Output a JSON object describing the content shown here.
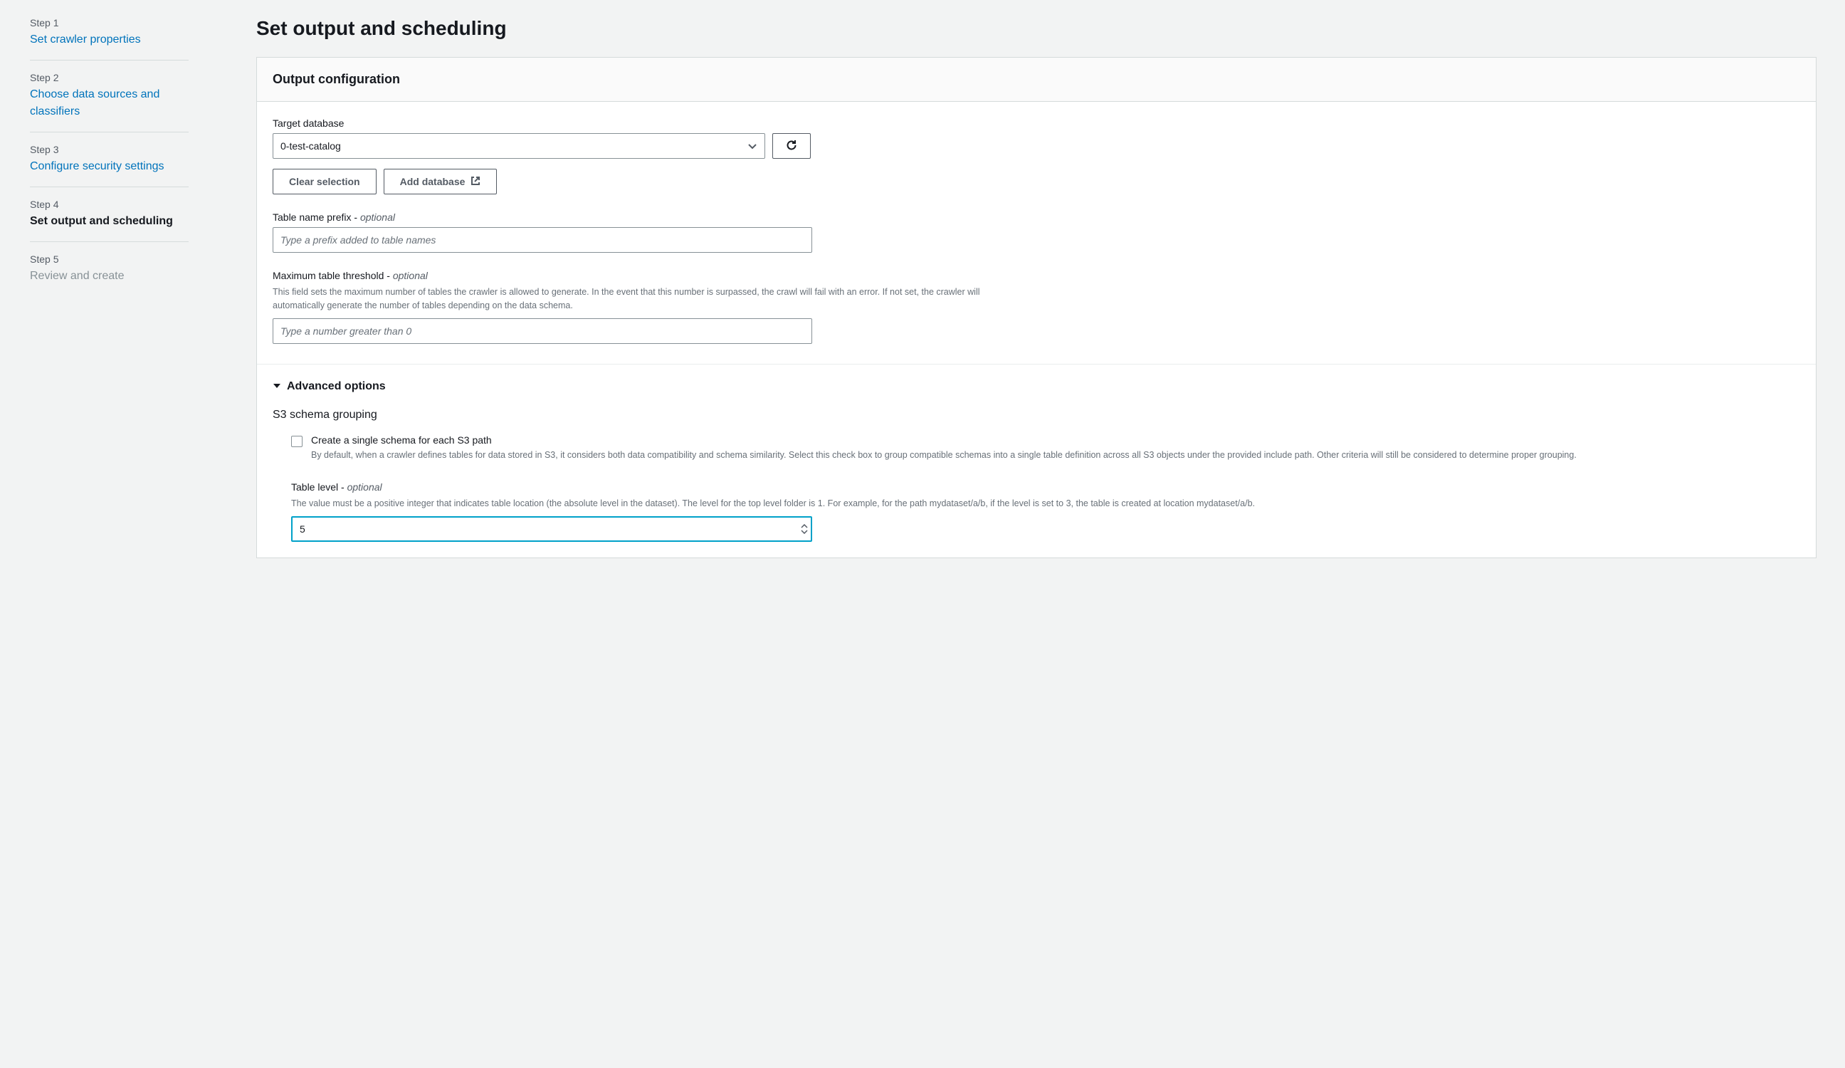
{
  "sidebar": {
    "steps": [
      {
        "label": "Step 1",
        "title": "Set crawler properties",
        "state": "link"
      },
      {
        "label": "Step 2",
        "title": "Choose data sources and classifiers",
        "state": "link"
      },
      {
        "label": "Step 3",
        "title": "Configure security settings",
        "state": "link"
      },
      {
        "label": "Step 4",
        "title": "Set output and scheduling",
        "state": "active"
      },
      {
        "label": "Step 5",
        "title": "Review and create",
        "state": "disabled"
      }
    ]
  },
  "page": {
    "title": "Set output and scheduling"
  },
  "output": {
    "panel_title": "Output configuration",
    "target_db": {
      "label": "Target database",
      "value": "0-test-catalog"
    },
    "clear_btn": "Clear selection",
    "add_db_btn": "Add database",
    "prefix": {
      "label": "Table name prefix - ",
      "optional": "optional",
      "placeholder": "Type a prefix added to table names",
      "value": ""
    },
    "max_threshold": {
      "label": "Maximum table threshold - ",
      "optional": "optional",
      "help": "This field sets the maximum number of tables the crawler is allowed to generate. In the event that this number is surpassed, the crawl will fail with an error. If not set, the crawler will automatically generate the number of tables depending on the data schema.",
      "placeholder": "Type a number greater than 0",
      "value": ""
    },
    "advanced_label": "Advanced options",
    "s3_grouping_heading": "S3 schema grouping",
    "single_schema": {
      "label": "Create a single schema for each S3 path",
      "help": "By default, when a crawler defines tables for data stored in S3, it considers both data compatibility and schema similarity. Select this check box to group compatible schemas into a single table definition across all S3 objects under the provided include path. Other criteria will still be considered to determine proper grouping.",
      "checked": false
    },
    "table_level": {
      "label": "Table level - ",
      "optional": "optional",
      "help": "The value must be a positive integer that indicates table location (the absolute level in the dataset). The level for the top level folder is 1. For example, for the path mydataset/a/b, if the level is set to 3, the table is created at location mydataset/a/b.",
      "value": "5"
    }
  }
}
